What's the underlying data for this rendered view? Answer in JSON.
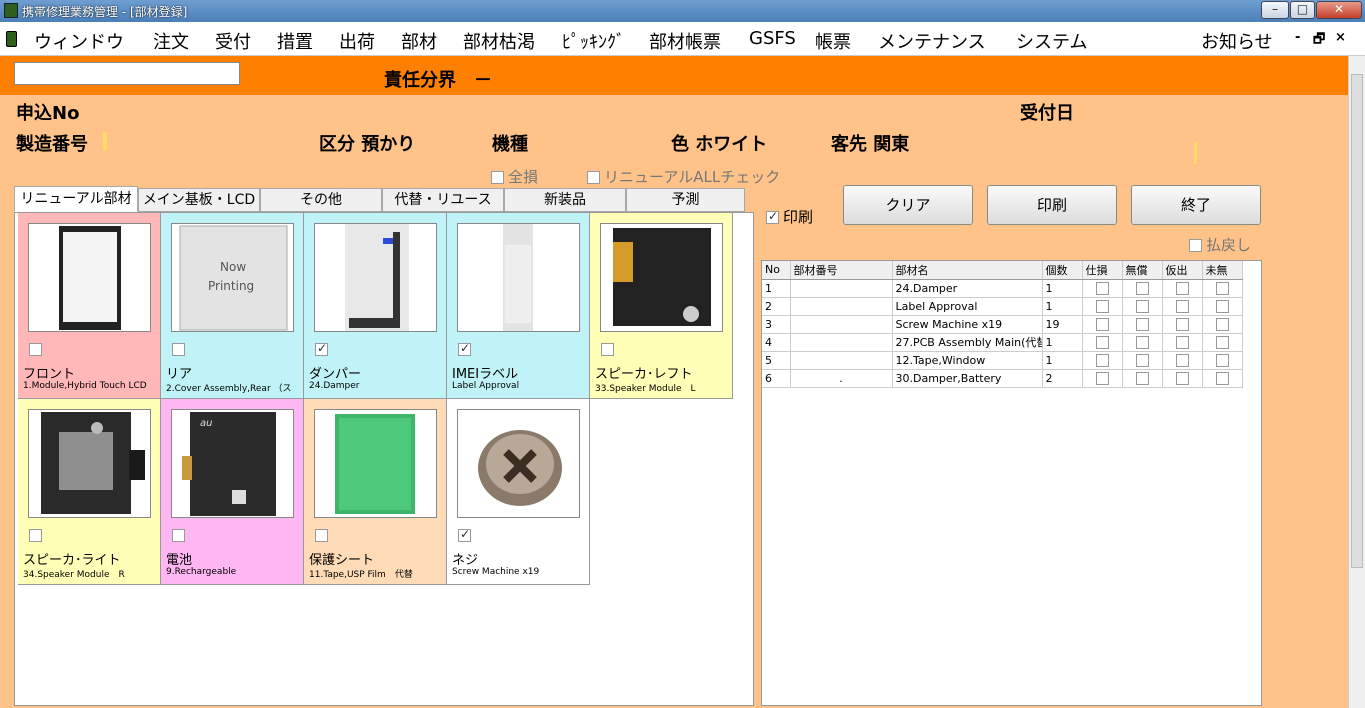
{
  "window": {
    "title": "携帯修理業務管理 - [部材登録]",
    "min": "–",
    "max": "□",
    "close": "✕"
  },
  "menu": {
    "items": [
      "ウィンドウ",
      "注文",
      "受付",
      "措置",
      "出荷",
      "部材",
      "部材枯渇",
      "ﾋﾟｯｷﾝｸﾞ",
      "部材帳票",
      "GSFS",
      "帳票",
      "メンテナンス",
      "システム"
    ],
    "notice": "お知らせ",
    "ctrl_min": "-",
    "ctrl_restore": "🗗",
    "ctrl_close": "×"
  },
  "header": {
    "search_value": "",
    "responsibility": "責任分界　－",
    "apply_no": "申込No",
    "received_date": "受付日",
    "serial_no": "製造番号",
    "category": "区分 預かり",
    "model": "機種",
    "color": "色 ホワイト",
    "customer": "客先 関東"
  },
  "checks": {
    "total_loss": "全損",
    "renewal_all": "リニューアルALLチェック",
    "print": "印刷",
    "refund": "払戻し"
  },
  "buttons": {
    "clear": "クリア",
    "print": "印刷",
    "exit": "終了"
  },
  "tabs": [
    "リニューアル部材",
    "メイン基板・LCD",
    "その他",
    "代替・リユース",
    "新装品",
    "予測"
  ],
  "parts": [
    {
      "jp": "フロント",
      "en": "1.Module,Hybrid Touch LCD",
      "checked": false,
      "bg": "#ffb7b7",
      "img": "lcd"
    },
    {
      "jp": "リア",
      "en": "2.Cover Assembly,Rear （ス",
      "checked": false,
      "bg": "#bff3f7",
      "img": "nowprinting",
      "img_text1": "Now",
      "img_text2": "Printing"
    },
    {
      "jp": "ダンパー",
      "en": "24.Damper",
      "checked": true,
      "bg": "#bff3f7",
      "img": "damper"
    },
    {
      "jp": "IMEIラベル",
      "en": "Label Approval",
      "checked": true,
      "bg": "#bff3f7",
      "img": "label"
    },
    {
      "jp": "スピーカ･レフト",
      "en": "33.Speaker Module　L",
      "checked": false,
      "bg": "#ffffb7",
      "img": "speakerL"
    },
    {
      "jp": "スピーカ･ライト",
      "en": "34.Speaker Module　R",
      "checked": false,
      "bg": "#ffffb7",
      "img": "speakerR"
    },
    {
      "jp": "電池",
      "en": "9.Rechargeable",
      "checked": false,
      "bg": "#ffb7f3",
      "img": "battery",
      "img_text1": "au"
    },
    {
      "jp": "保護シート",
      "en": "11.Tape,USP Film　代替",
      "checked": false,
      "bg": "#ffdcb7",
      "img": "film"
    },
    {
      "jp": "ネジ",
      "en": "Screw Machine x19",
      "checked": true,
      "bg": "#ffffff",
      "img": "screw"
    }
  ],
  "grid": {
    "headers": [
      "No",
      "部材番号",
      "部材名",
      "個数",
      "仕損",
      "無償",
      "仮出",
      "未無"
    ],
    "rows": [
      {
        "no": "1",
        "part_no": "",
        "name": "24.Damper",
        "qty": "1"
      },
      {
        "no": "2",
        "part_no": "",
        "name": "Label Approval",
        "qty": "1"
      },
      {
        "no": "3",
        "part_no": "",
        "name": "Screw Machine x19",
        "qty": "19"
      },
      {
        "no": "4",
        "part_no": "",
        "name": "27.PCB Assembly Main(代替",
        "qty": "1"
      },
      {
        "no": "5",
        "part_no": "",
        "name": "12.Tape,Window",
        "qty": "1"
      },
      {
        "no": "6",
        "part_no": ".",
        "name": "30.Damper,Battery",
        "qty": "2"
      }
    ]
  }
}
